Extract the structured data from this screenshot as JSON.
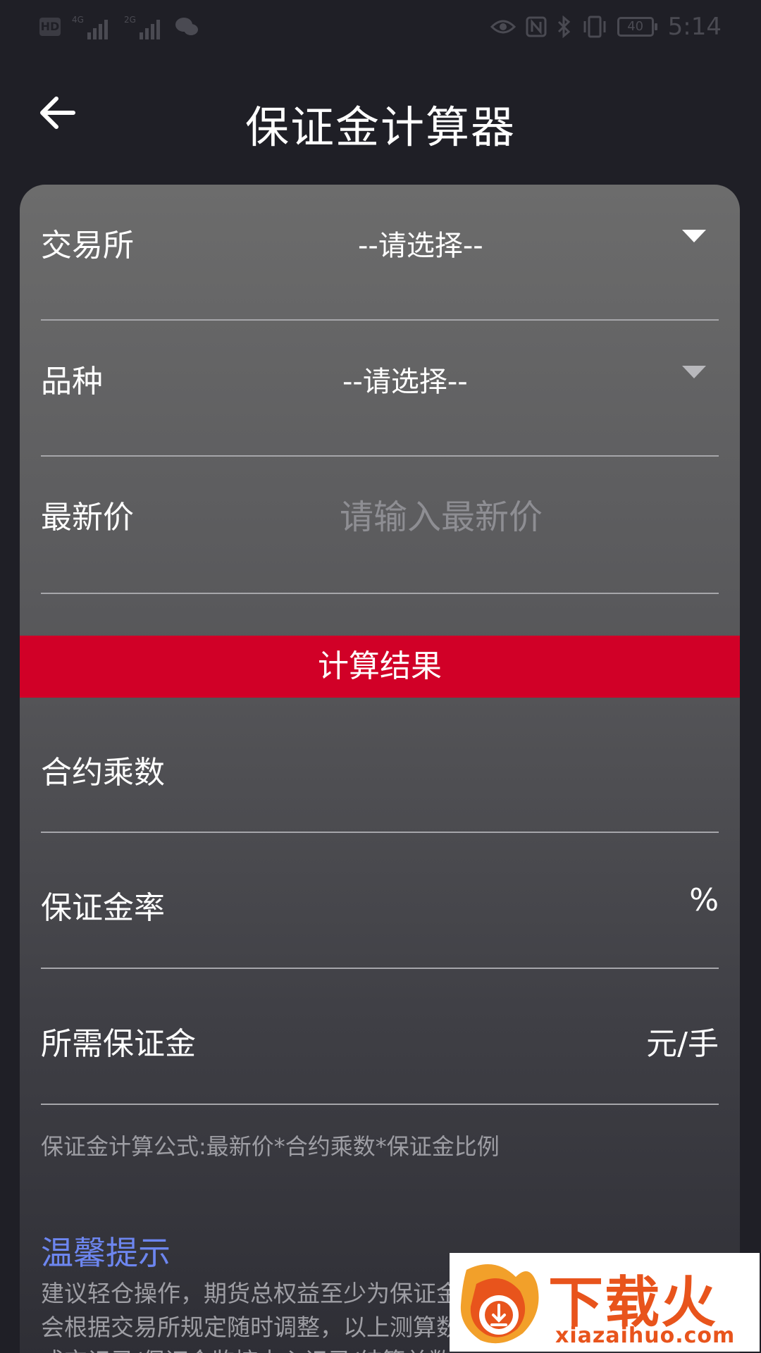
{
  "status_bar": {
    "network_1": "4G",
    "network_2": "2G",
    "battery": "40",
    "time": "5:14"
  },
  "header": {
    "title": "保证金计算器"
  },
  "form": {
    "exchange": {
      "label": "交易所",
      "value": "--请选择--"
    },
    "variety": {
      "label": "品种",
      "value": "--请选择--"
    },
    "latest_price": {
      "label": "最新价",
      "placeholder": "请输入最新价"
    }
  },
  "result": {
    "title": "计算结果",
    "contract_multiplier": {
      "label": "合约乘数",
      "value": ""
    },
    "margin_rate": {
      "label": "保证金率",
      "unit": "%"
    },
    "required_margin": {
      "label": "所需保证金",
      "unit": "元/手"
    }
  },
  "formula_note": "保证金计算公式:最新价*合约乘数*保证金比例",
  "tips": {
    "title": "温馨提示",
    "line1": "建议轻仓操作，期货总权益至少为保证金",
    "line2": "会根据交易所规定随时调整，以上测算数",
    "line3": "成交记录/保证金监控中心记录/结算单数"
  },
  "watermark": {
    "brand": "下载火",
    "url": "xiazaihuo.com"
  },
  "colors": {
    "accent_red": "#d10027",
    "tips_blue": "#6d86f0",
    "background": "#1f1f26"
  }
}
